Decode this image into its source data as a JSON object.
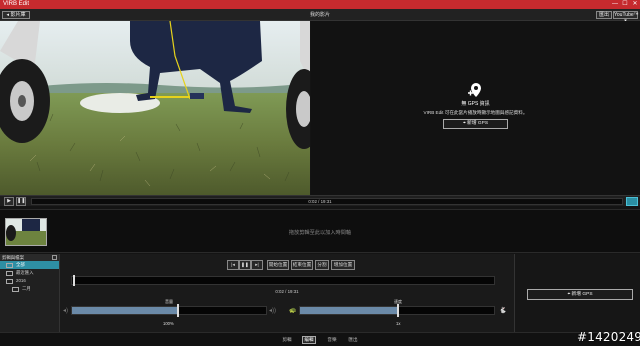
{
  "window": {
    "title": "VIRB Edit",
    "minimize": "—",
    "maximize": "☐",
    "close": "✕"
  },
  "toolbar": {
    "back_label": "影片庫",
    "project_title": "我的影片",
    "export_label": "匯出",
    "share_label": "YouTube™"
  },
  "map_panel": {
    "gps_title": "無 GPS 資訊",
    "gps_desc": "VIRB Edit 可在此當片播放時顯示地圖與感記資料。",
    "add_gps_label": "新增 GPS"
  },
  "playback": {
    "play_icon": "play-icon",
    "pause_icon": "pause-icon",
    "time": "0:02 / 19:31",
    "progress": 0.001
  },
  "clip_strip": {
    "hint": "拖放剪輯至此以加入時間軸"
  },
  "library": {
    "header": "剪輯與檔案",
    "items": [
      {
        "label": "全部",
        "selected": true,
        "indent": 0
      },
      {
        "label": "最近匯入",
        "selected": false,
        "indent": 0
      },
      {
        "label": "2016",
        "selected": false,
        "indent": 0
      },
      {
        "label": "二月",
        "selected": false,
        "indent": 1
      }
    ]
  },
  "controls": {
    "set_start": "開始位置",
    "set_end": "結束位置",
    "split": "分割",
    "add_to_timeline": "增加位置",
    "time": "0:02 / 19:31",
    "volume": {
      "caption": "音量",
      "value_label": "100%",
      "level": 0.54
    },
    "speed": {
      "caption": "速度",
      "value_label": "1x",
      "level": 0.5
    }
  },
  "right_pane": {
    "add_gps_label": "新增 GPS"
  },
  "tabs": [
    {
      "label": "剪輯",
      "active": false
    },
    {
      "label": "編輯",
      "active": true
    },
    {
      "label": "音樂",
      "active": false
    },
    {
      "label": "匯出",
      "active": false
    }
  ],
  "watermark": "#1420249"
}
